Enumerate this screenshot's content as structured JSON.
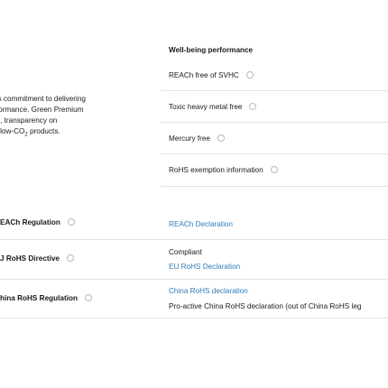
{
  "right": {
    "heading": "Well-being performance",
    "items": [
      {
        "label": "REACh free of SVHC"
      },
      {
        "label": "Toxic heavy metal free"
      },
      {
        "label": "Mercury free"
      },
      {
        "label": "RoHS exemption information"
      }
    ],
    "rows": [
      {
        "link": "REACh Declaration"
      },
      {
        "status": "Compliant",
        "link": "EU RoHS Declaration"
      },
      {
        "link": "China RoHS declaration",
        "note": "Pro-active China RoHS declaration (out of China RoHS leg"
      }
    ]
  },
  "left": {
    "desc_lines": [
      "'s commitment to delivering",
      "formance. Green Premium",
      "s, transparency on",
      "l low-CO",
      "products."
    ],
    "co2_sub": "2",
    "regulations": [
      {
        "label": "EACh Regulation"
      },
      {
        "label": "J RoHS Directive"
      },
      {
        "label": "hina RoHS Regulation"
      }
    ]
  }
}
